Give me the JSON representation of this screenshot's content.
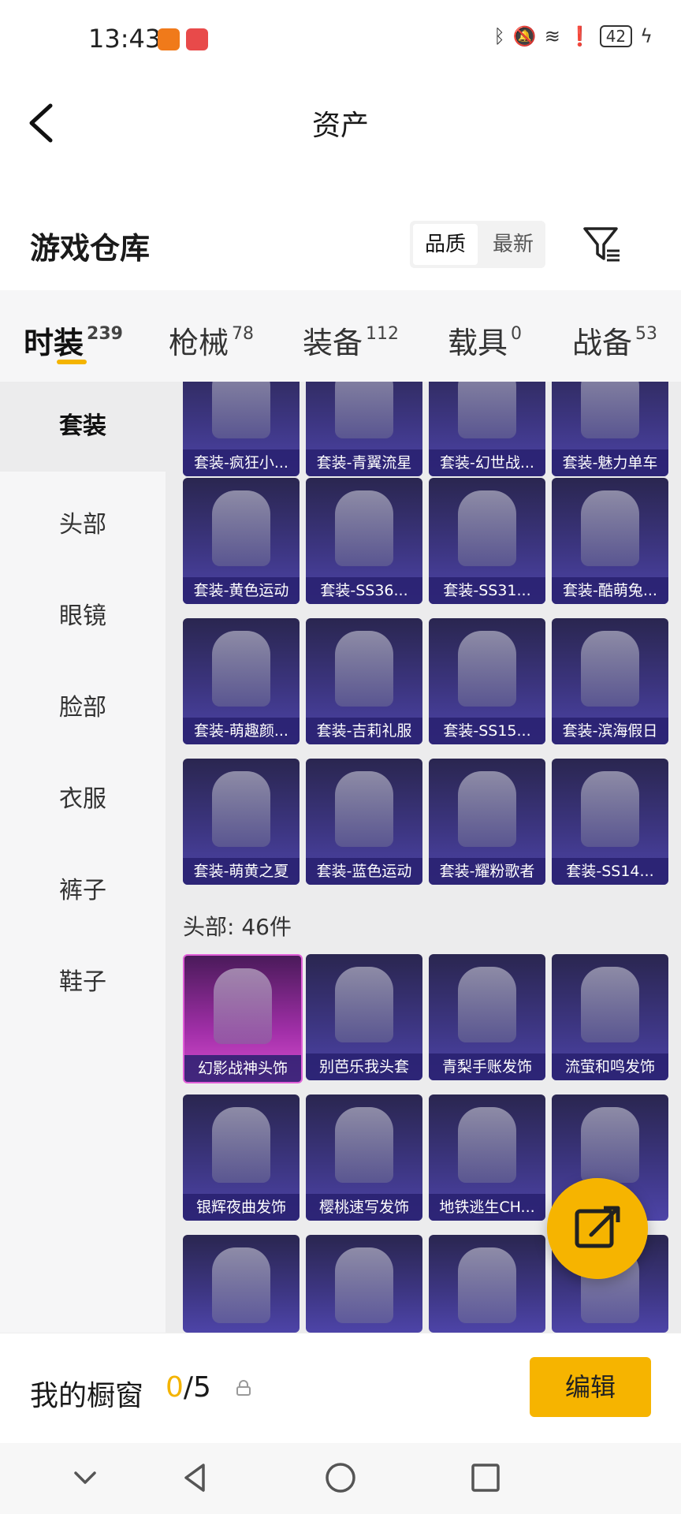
{
  "status_bar": {
    "time": "13:43",
    "battery": "42"
  },
  "header": {
    "title": "资产"
  },
  "warehouse": {
    "title": "游戏仓库",
    "sort_quality": "品质",
    "sort_newest": "最新"
  },
  "tabs": [
    {
      "label": "时装",
      "count": "239"
    },
    {
      "label": "枪械",
      "count": "78"
    },
    {
      "label": "装备",
      "count": "112"
    },
    {
      "label": "载具",
      "count": "0"
    },
    {
      "label": "战备",
      "count": "53"
    }
  ],
  "sidebar": [
    {
      "label": "套装"
    },
    {
      "label": "头部"
    },
    {
      "label": "眼镜"
    },
    {
      "label": "脸部"
    },
    {
      "label": "衣服"
    },
    {
      "label": "裤子"
    },
    {
      "label": "鞋子"
    }
  ],
  "suits": [
    "套装-疯狂小...",
    "套装-青翼流星",
    "套装-幻世战...",
    "套装-魅力单车",
    "套装-黄色运动",
    "套装-SS36...",
    "套装-SS31...",
    "套装-酷萌兔...",
    "套装-萌趣颜...",
    "套装-吉莉礼服",
    "套装-SS15...",
    "套装-滨海假日",
    "套装-萌黄之夏",
    "套装-蓝色运动",
    "套装-耀粉歌者",
    "套装-SS14..."
  ],
  "head_section": {
    "title": "头部: 46件"
  },
  "head_items": [
    "幻影战神头饰",
    "别芭乐我头套",
    "青梨手账发饰",
    "流萤和鸣发饰",
    "银辉夜曲发饰",
    "樱桃速写发饰",
    "地铁逃生CH...",
    "",
    "",
    "",
    "",
    ""
  ],
  "bottom": {
    "showcase_label": "我的橱窗",
    "used": "0",
    "total": "/5",
    "edit_label": "编辑"
  }
}
